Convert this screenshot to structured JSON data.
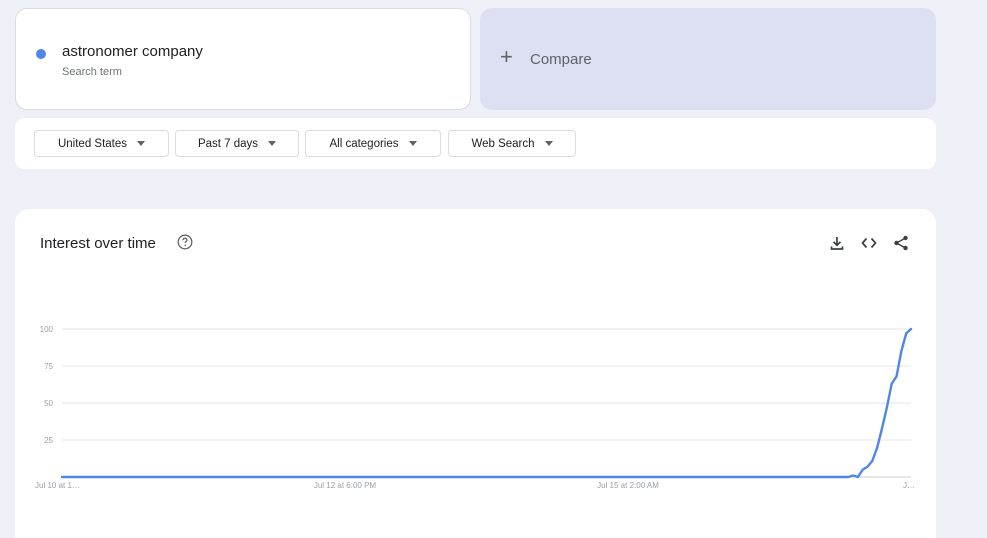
{
  "search_term": {
    "name": "astronomer company",
    "subtitle": "Search term",
    "color": "#4f86e8"
  },
  "compare": {
    "plus": "+",
    "label": "Compare"
  },
  "filters": {
    "region": "United States",
    "time_range": "Past 7 days",
    "category": "All categories",
    "search_type": "Web Search"
  },
  "chart_section": {
    "title": "Interest over time",
    "icons": [
      "help-icon",
      "download-icon",
      "embed-icon",
      "share-icon"
    ]
  },
  "chart_data": {
    "type": "line",
    "series": [
      {
        "color": "#4f86e8",
        "values": [
          0,
          0,
          0,
          0,
          0,
          0,
          0,
          0,
          0,
          0,
          0,
          0,
          0,
          0,
          0,
          0,
          0,
          0,
          0,
          0,
          0,
          0,
          0,
          0,
          0,
          0,
          0,
          0,
          0,
          0,
          0,
          0,
          0,
          0,
          0,
          0,
          0,
          0,
          0,
          0,
          0,
          0,
          0,
          0,
          0,
          0,
          0,
          0,
          0,
          0,
          0,
          0,
          0,
          0,
          0,
          0,
          0,
          0,
          0,
          0,
          0,
          0,
          0,
          0,
          0,
          0,
          0,
          0,
          0,
          0,
          0,
          0,
          0,
          0,
          0,
          0,
          0,
          0,
          0,
          0,
          0,
          0,
          0,
          0,
          0,
          0,
          0,
          0,
          0,
          0,
          0,
          0,
          0,
          0,
          0,
          0,
          0,
          0,
          0,
          0,
          0,
          0,
          0,
          0,
          0,
          0,
          0,
          0,
          0,
          0,
          0,
          0,
          0,
          0,
          0,
          0,
          0,
          0,
          0,
          0,
          0,
          0,
          0,
          0,
          0,
          0,
          0,
          0,
          0,
          0,
          0,
          0,
          0,
          0,
          0,
          0,
          0,
          0,
          0,
          0,
          0,
          0,
          0,
          0,
          0,
          0,
          0,
          0,
          0,
          0,
          0,
          0,
          0,
          0,
          0,
          0,
          0,
          0,
          0,
          0,
          0,
          0,
          0,
          0,
          1,
          0,
          5,
          7,
          11,
          20,
          33,
          47,
          63,
          68,
          85,
          97,
          100
        ]
      }
    ],
    "x_tick_labels": [
      "Jul 10 at 1…",
      "Jul 12 at 6:00 PM",
      "Jul 15 at 2:00 AM",
      "J…"
    ],
    "y_ticks": [
      "100",
      "75",
      "50",
      "25"
    ],
    "ylim": [
      0,
      100
    ],
    "grid": true,
    "legend": "none"
  }
}
